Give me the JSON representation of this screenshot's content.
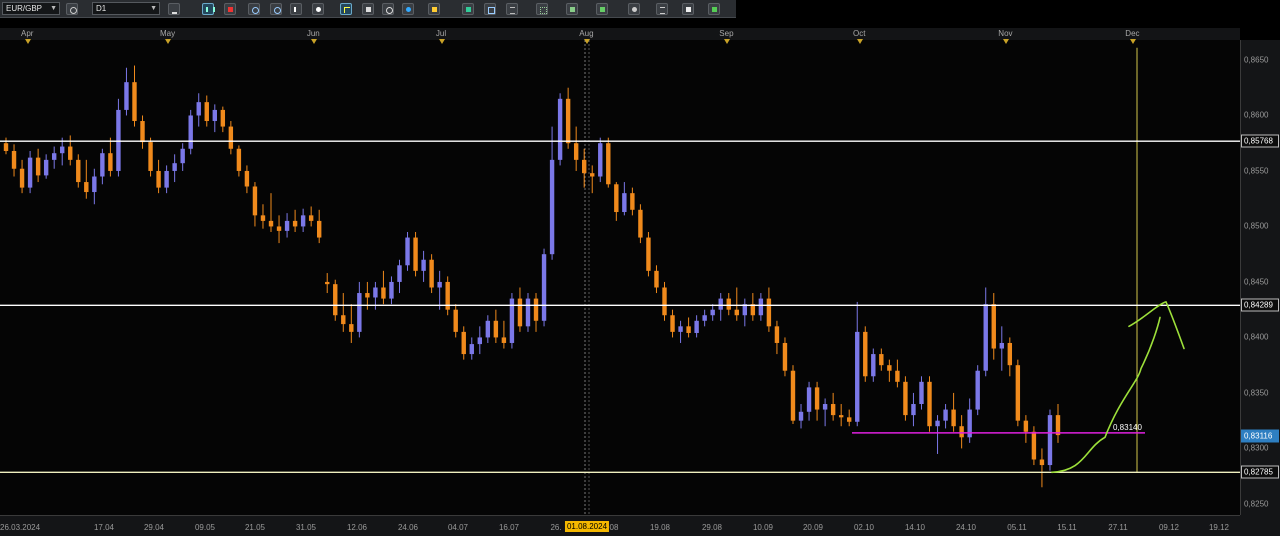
{
  "toolbar": {
    "symbol": "EUR/GBP",
    "timeframe": "D1",
    "icons": [
      "link-icon",
      "chart-type-icon",
      "bar-chart-icon",
      "indicator-icon",
      "zoom-in-icon",
      "zoom-out-icon",
      "cursor-icon",
      "dot-icon",
      "crosshair-icon",
      "template-icon",
      "eye-icon",
      "globe-icon",
      "pencil-icon",
      "trend-icon",
      "window-icon",
      "fibonacci-icon",
      "grid-icon",
      "alert-icon",
      "circle-icon",
      "object-list-icon",
      "eraser-icon",
      "settings-icon"
    ]
  },
  "chart_data": {
    "type": "candlestick",
    "symbol": "EUR/GBP",
    "timeframe": "D1",
    "price_range": [
      0.824,
      0.8668
    ],
    "price_ticks": [
      "0,8650",
      "0,8600",
      "0,8550",
      "0,8500",
      "0,8450",
      "0,8400",
      "0,8350",
      "0,8300",
      "0,8250"
    ],
    "month_labels": [
      "Apr",
      "May",
      "Jun",
      "Jul",
      "Aug",
      "Sep",
      "Oct",
      "Nov",
      "Dec"
    ],
    "date_labels": [
      "26.03.2024",
      "17.04",
      "29.04",
      "09.05",
      "21.05",
      "31.05",
      "12.06",
      "24.06",
      "04.07",
      "16.07",
      "26.",
      "08",
      "19.08",
      "29.08",
      "10.09",
      "20.09",
      "02.10",
      "14.10",
      "24.10",
      "05.11",
      "15.11",
      "27.11",
      "09.12",
      "19.12"
    ],
    "highlighted_date": "01.08.2024",
    "horizontal_levels": [
      {
        "price": 0.85768,
        "label": "0,85768",
        "color": "#ffffff"
      },
      {
        "price": 0.84289,
        "label": "0,84289",
        "color": "#ffffff"
      },
      {
        "price": 0.82785,
        "label": "0,82785",
        "color": "#f0f0c0"
      }
    ],
    "segment_level": {
      "price": 0.8314,
      "label": "0,83140",
      "color": "#e020e0"
    },
    "current_price": {
      "price": 0.83116,
      "label": "0,83116",
      "color": "#2e7fc2"
    },
    "colors": {
      "bull": "#7b78e8",
      "bear": "#f08a1c",
      "forecast": "#9de03a",
      "vline": "#d4c84a"
    },
    "candles": [
      [
        0.8575,
        0.858,
        0.8565,
        0.8568
      ],
      [
        0.8568,
        0.8574,
        0.8545,
        0.8552
      ],
      [
        0.8552,
        0.856,
        0.853,
        0.8535
      ],
      [
        0.8535,
        0.8568,
        0.853,
        0.8562
      ],
      [
        0.8562,
        0.857,
        0.854,
        0.8546
      ],
      [
        0.8546,
        0.8565,
        0.8543,
        0.856
      ],
      [
        0.856,
        0.8572,
        0.8552,
        0.8566
      ],
      [
        0.8566,
        0.858,
        0.8555,
        0.8572
      ],
      [
        0.8572,
        0.8582,
        0.8555,
        0.856
      ],
      [
        0.856,
        0.8565,
        0.8535,
        0.854
      ],
      [
        0.854,
        0.856,
        0.8525,
        0.8531
      ],
      [
        0.8531,
        0.8552,
        0.852,
        0.8545
      ],
      [
        0.8545,
        0.857,
        0.8538,
        0.8566
      ],
      [
        0.8566,
        0.858,
        0.8545,
        0.855
      ],
      [
        0.855,
        0.8615,
        0.8545,
        0.8605
      ],
      [
        0.8605,
        0.8643,
        0.86,
        0.863
      ],
      [
        0.863,
        0.8645,
        0.859,
        0.8595
      ],
      [
        0.8595,
        0.86,
        0.857,
        0.8576
      ],
      [
        0.8576,
        0.858,
        0.8545,
        0.855
      ],
      [
        0.855,
        0.856,
        0.853,
        0.8535
      ],
      [
        0.8535,
        0.8555,
        0.853,
        0.855
      ],
      [
        0.855,
        0.8565,
        0.854,
        0.8557
      ],
      [
        0.8557,
        0.8575,
        0.855,
        0.857
      ],
      [
        0.857,
        0.8605,
        0.8565,
        0.86
      ],
      [
        0.86,
        0.862,
        0.859,
        0.8612
      ],
      [
        0.8612,
        0.8618,
        0.859,
        0.8595
      ],
      [
        0.8595,
        0.861,
        0.8585,
        0.8605
      ],
      [
        0.8605,
        0.8608,
        0.8585,
        0.859
      ],
      [
        0.859,
        0.8595,
        0.8565,
        0.857
      ],
      [
        0.857,
        0.8573,
        0.8545,
        0.855
      ],
      [
        0.855,
        0.8555,
        0.853,
        0.8536
      ],
      [
        0.8536,
        0.854,
        0.85,
        0.851
      ],
      [
        0.851,
        0.852,
        0.8498,
        0.8505
      ],
      [
        0.8505,
        0.853,
        0.8495,
        0.85
      ],
      [
        0.85,
        0.851,
        0.8485,
        0.8496
      ],
      [
        0.8496,
        0.8512,
        0.849,
        0.8505
      ],
      [
        0.8505,
        0.8515,
        0.8495,
        0.85
      ],
      [
        0.85,
        0.8516,
        0.8495,
        0.851
      ],
      [
        0.851,
        0.8518,
        0.85,
        0.8505
      ],
      [
        0.8505,
        0.8515,
        0.8485,
        0.849
      ],
      [
        0.845,
        0.8458,
        0.844,
        0.8448
      ],
      [
        0.8448,
        0.8452,
        0.8415,
        0.842
      ],
      [
        0.842,
        0.844,
        0.8405,
        0.8412
      ],
      [
        0.8412,
        0.843,
        0.8395,
        0.8405
      ],
      [
        0.8405,
        0.845,
        0.84,
        0.844
      ],
      [
        0.844,
        0.845,
        0.8425,
        0.8436
      ],
      [
        0.8436,
        0.845,
        0.8425,
        0.8445
      ],
      [
        0.8445,
        0.846,
        0.843,
        0.8435
      ],
      [
        0.8435,
        0.8455,
        0.843,
        0.845
      ],
      [
        0.845,
        0.847,
        0.844,
        0.8465
      ],
      [
        0.8465,
        0.8495,
        0.846,
        0.849
      ],
      [
        0.849,
        0.8495,
        0.8455,
        0.846
      ],
      [
        0.846,
        0.8478,
        0.845,
        0.847
      ],
      [
        0.847,
        0.8475,
        0.844,
        0.8445
      ],
      [
        0.8445,
        0.846,
        0.8425,
        0.845
      ],
      [
        0.845,
        0.8455,
        0.842,
        0.8425
      ],
      [
        0.8425,
        0.843,
        0.84,
        0.8405
      ],
      [
        0.8405,
        0.841,
        0.838,
        0.8385
      ],
      [
        0.8385,
        0.84,
        0.838,
        0.8394
      ],
      [
        0.8394,
        0.841,
        0.8385,
        0.84
      ],
      [
        0.84,
        0.842,
        0.8395,
        0.8415
      ],
      [
        0.8415,
        0.8425,
        0.8395,
        0.84
      ],
      [
        0.84,
        0.8415,
        0.839,
        0.8395
      ],
      [
        0.8395,
        0.844,
        0.839,
        0.8435
      ],
      [
        0.8435,
        0.8445,
        0.8405,
        0.841
      ],
      [
        0.841,
        0.844,
        0.8405,
        0.8435
      ],
      [
        0.8435,
        0.844,
        0.8405,
        0.8415
      ],
      [
        0.8415,
        0.848,
        0.841,
        0.8475
      ],
      [
        0.8475,
        0.859,
        0.847,
        0.856
      ],
      [
        0.856,
        0.862,
        0.8555,
        0.8615
      ],
      [
        0.8615,
        0.8625,
        0.857,
        0.8575
      ],
      [
        0.8575,
        0.859,
        0.855,
        0.856
      ],
      [
        0.856,
        0.857,
        0.8535,
        0.8548
      ],
      [
        0.8548,
        0.8555,
        0.853,
        0.8545
      ],
      [
        0.8545,
        0.858,
        0.854,
        0.8575
      ],
      [
        0.8575,
        0.858,
        0.8535,
        0.8538
      ],
      [
        0.8538,
        0.854,
        0.8505,
        0.8513
      ],
      [
        0.8513,
        0.854,
        0.851,
        0.853
      ],
      [
        0.853,
        0.8535,
        0.851,
        0.8515
      ],
      [
        0.8515,
        0.852,
        0.8485,
        0.849
      ],
      [
        0.849,
        0.8495,
        0.8455,
        0.846
      ],
      [
        0.846,
        0.8465,
        0.844,
        0.8445
      ],
      [
        0.8445,
        0.845,
        0.8415,
        0.842
      ],
      [
        0.842,
        0.8425,
        0.84,
        0.8405
      ],
      [
        0.8405,
        0.8415,
        0.8395,
        0.841
      ],
      [
        0.841,
        0.8418,
        0.84,
        0.8404
      ],
      [
        0.8404,
        0.842,
        0.84,
        0.8415
      ],
      [
        0.8415,
        0.8425,
        0.841,
        0.842
      ],
      [
        0.842,
        0.843,
        0.8415,
        0.8425
      ],
      [
        0.8425,
        0.844,
        0.8415,
        0.8435
      ],
      [
        0.8435,
        0.844,
        0.842,
        0.8425
      ],
      [
        0.8425,
        0.8445,
        0.8415,
        0.842
      ],
      [
        0.842,
        0.8435,
        0.841,
        0.843
      ],
      [
        0.843,
        0.844,
        0.8415,
        0.842
      ],
      [
        0.842,
        0.844,
        0.8415,
        0.8435
      ],
      [
        0.8435,
        0.8445,
        0.8405,
        0.841
      ],
      [
        0.841,
        0.8415,
        0.8385,
        0.8395
      ],
      [
        0.8395,
        0.84,
        0.8365,
        0.837
      ],
      [
        0.837,
        0.8375,
        0.8322,
        0.8325
      ],
      [
        0.8325,
        0.834,
        0.8318,
        0.8333
      ],
      [
        0.8333,
        0.836,
        0.8325,
        0.8355
      ],
      [
        0.8355,
        0.836,
        0.8325,
        0.8335
      ],
      [
        0.8335,
        0.8345,
        0.832,
        0.834
      ],
      [
        0.834,
        0.835,
        0.8325,
        0.833
      ],
      [
        0.833,
        0.834,
        0.832,
        0.8328
      ],
      [
        0.8328,
        0.8335,
        0.832,
        0.8324
      ],
      [
        0.8324,
        0.8432,
        0.832,
        0.8405
      ],
      [
        0.8405,
        0.841,
        0.836,
        0.8365
      ],
      [
        0.8365,
        0.839,
        0.836,
        0.8385
      ],
      [
        0.8385,
        0.839,
        0.837,
        0.8375
      ],
      [
        0.8375,
        0.838,
        0.836,
        0.837
      ],
      [
        0.837,
        0.838,
        0.8355,
        0.836
      ],
      [
        0.836,
        0.8365,
        0.8325,
        0.833
      ],
      [
        0.833,
        0.835,
        0.832,
        0.834
      ],
      [
        0.834,
        0.8365,
        0.8335,
        0.836
      ],
      [
        0.836,
        0.8365,
        0.8315,
        0.832
      ],
      [
        0.832,
        0.833,
        0.8295,
        0.8325
      ],
      [
        0.8325,
        0.834,
        0.8318,
        0.8335
      ],
      [
        0.8335,
        0.835,
        0.8315,
        0.832
      ],
      [
        0.832,
        0.833,
        0.83,
        0.831
      ],
      [
        0.831,
        0.8345,
        0.8305,
        0.8335
      ],
      [
        0.8335,
        0.8375,
        0.833,
        0.837
      ],
      [
        0.837,
        0.8445,
        0.8365,
        0.843
      ],
      [
        0.843,
        0.844,
        0.838,
        0.839
      ],
      [
        0.839,
        0.841,
        0.837,
        0.8395
      ],
      [
        0.8395,
        0.84,
        0.8365,
        0.8375
      ],
      [
        0.8375,
        0.838,
        0.832,
        0.8325
      ],
      [
        0.8325,
        0.833,
        0.8305,
        0.8315
      ],
      [
        0.8315,
        0.832,
        0.8285,
        0.829
      ],
      [
        0.829,
        0.83,
        0.8265,
        0.8285
      ],
      [
        0.8285,
        0.8335,
        0.828,
        0.833
      ],
      [
        0.833,
        0.834,
        0.8305,
        0.8312
      ]
    ],
    "forecast_path": [
      [
        0.82785,
        0.82785
      ],
      [
        0.828,
        0.83
      ],
      [
        0.832,
        0.8375
      ],
      [
        0.8395,
        0.8432
      ]
    ]
  }
}
